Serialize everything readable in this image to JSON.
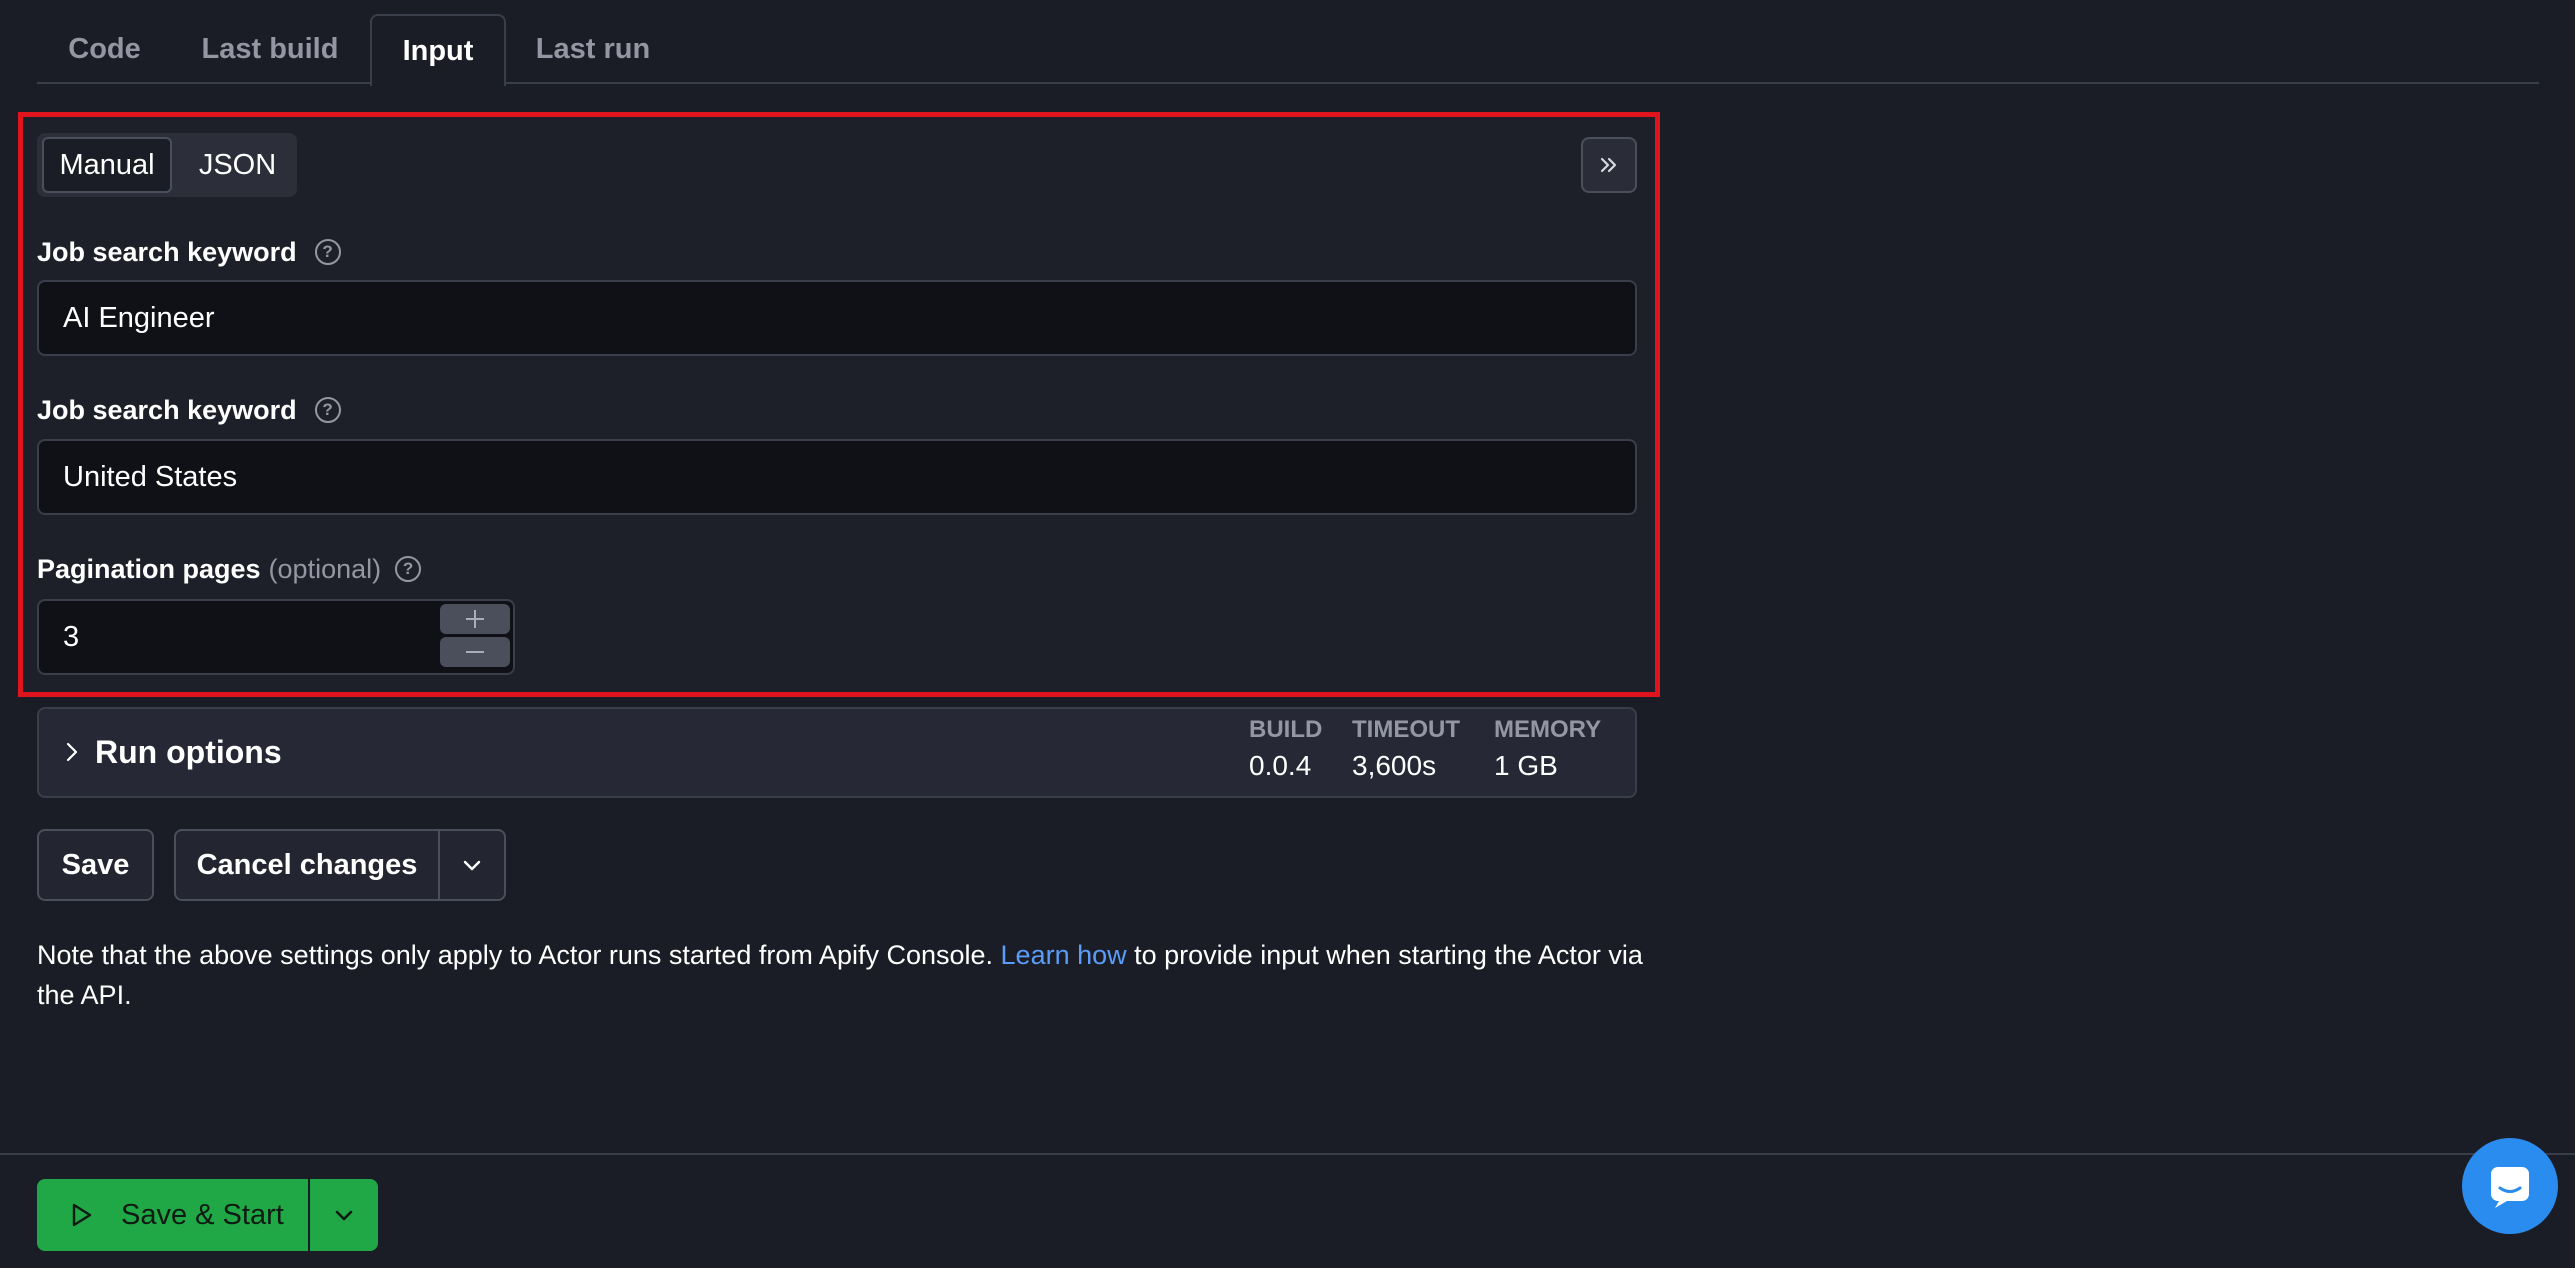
{
  "tabs": [
    {
      "label": "Code"
    },
    {
      "label": "Last build"
    },
    {
      "label": "Input"
    },
    {
      "label": "Last run"
    }
  ],
  "mode_toggle": {
    "manual": "Manual",
    "json": "JSON"
  },
  "fields": {
    "keyword": {
      "label": "Job search keyword",
      "value": "AI Engineer"
    },
    "location": {
      "label": "Job search keyword",
      "value": "United States"
    },
    "pages": {
      "label": "Pagination pages",
      "optional": "(optional)",
      "value": "3"
    }
  },
  "run_options": {
    "title": "Run options",
    "build": {
      "label": "BUILD",
      "value": "0.0.4"
    },
    "timeout": {
      "label": "TIMEOUT",
      "value": "3,600s"
    },
    "memory": {
      "label": "MEMORY",
      "value": "1 GB"
    }
  },
  "actions": {
    "save": "Save",
    "cancel": "Cancel changes",
    "save_start": "Save & Start"
  },
  "note": {
    "before": "Note that the above settings only apply to Actor runs started from Apify Console. ",
    "link": "Learn how",
    "after": " to provide input when starting the Actor via the API."
  },
  "colors": {
    "highlight": "#e0141d",
    "accent_green": "#20a847",
    "link": "#5a9cf8",
    "chat": "#2b8cf0"
  },
  "icons": [
    "help-icon",
    "double-chevron-right-icon",
    "chevron-right-icon",
    "chevron-down-icon",
    "play-icon",
    "chat-icon",
    "plus-icon",
    "minus-icon"
  ]
}
